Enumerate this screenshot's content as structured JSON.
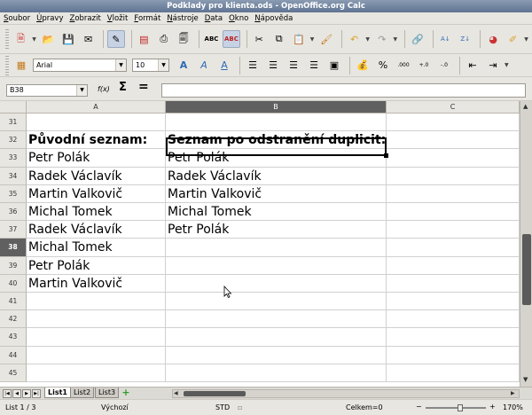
{
  "window": {
    "title": "Podklady pro klienta.ods - OpenOffice.org Calc"
  },
  "menu": [
    {
      "ul": "S",
      "rest": "oubor"
    },
    {
      "ul": "Ú",
      "rest": "pravy"
    },
    {
      "ul": "Z",
      "rest": "obrazit"
    },
    {
      "ul": "V",
      "rest": "ložit"
    },
    {
      "ul": "F",
      "rest": "ormát"
    },
    {
      "ul": "N",
      "rest": "ástroje"
    },
    {
      "ul": "D",
      "rest": "ata"
    },
    {
      "ul": "O",
      "rest": "kno"
    },
    {
      "ul": "N",
      "rest": "ápověda"
    }
  ],
  "format_toolbar": {
    "font_name": "Arial",
    "font_size": "10"
  },
  "formula_bar": {
    "cell_ref": "B38",
    "fx": "f(x)",
    "sum": "Σ",
    "equals": "=",
    "content": ""
  },
  "grid": {
    "columns": [
      "A",
      "B",
      "C"
    ],
    "selected_column": "B",
    "rows": [
      {
        "n": "31",
        "a": "",
        "b": ""
      },
      {
        "n": "32",
        "a": "Původní seznam:",
        "b": "Seznam po odstranění duplicit:",
        "bold": true
      },
      {
        "n": "33",
        "a": "Petr Polák",
        "b": "Petr Polák"
      },
      {
        "n": "34",
        "a": "Radek Václavík",
        "b": "Radek Václavík"
      },
      {
        "n": "35",
        "a": "Martin Valkovič",
        "b": "Martin Valkovič"
      },
      {
        "n": "36",
        "a": "Michal Tomek",
        "b": "Michal Tomek"
      },
      {
        "n": "37",
        "a": "Radek Václavík",
        "b": "Petr Polák"
      },
      {
        "n": "38",
        "a": "Michal Tomek",
        "b": ""
      },
      {
        "n": "39",
        "a": "Petr Polák",
        "b": ""
      },
      {
        "n": "40",
        "a": "Martin Valkovič",
        "b": ""
      },
      {
        "n": "41",
        "a": "",
        "b": ""
      },
      {
        "n": "42",
        "a": "",
        "b": ""
      },
      {
        "n": "43",
        "a": "",
        "b": ""
      },
      {
        "n": "44",
        "a": "",
        "b": ""
      },
      {
        "n": "45",
        "a": "",
        "b": ""
      }
    ],
    "selected_row": "38"
  },
  "sheets": {
    "tabs": [
      "List1",
      "List2",
      "List3"
    ],
    "active": "List1"
  },
  "status": {
    "sheet": "List 1 / 3",
    "style": "Výchozí",
    "mode": "STD",
    "sum": "Celkem=0",
    "zoom": "170%"
  },
  "colors": {
    "selected_header": "#606060",
    "title_bar": "#6d7f9b"
  }
}
